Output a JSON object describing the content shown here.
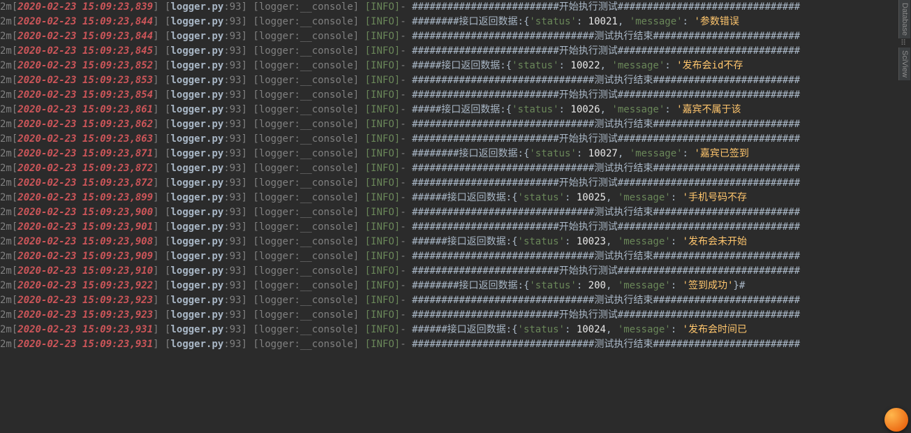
{
  "tools": {
    "database": "Database",
    "sciview": "SciView"
  },
  "log": {
    "prefix2m": "2m[",
    "file": "logger.py",
    "lineNo": "93",
    "logger": " [logger:__console] ",
    "level": "[INFO]",
    "dash": "- ",
    "hash_long": "#########################",
    "hash_longer": "###############################",
    "hash_mid": "########",
    "hash_short": "#####",
    "start": "开始执行测试",
    "end": "测试执行结束",
    "resp": "接口返回数据:",
    "statusKey": "'status'",
    "messageKey": "'message'",
    "colon": ": ",
    "comma": ", ",
    "brace_o": "{",
    "brace_c": "}",
    "tail_hashes": "###################",
    "entries": [
      {
        "ts": "2020-02-23 15:09:23,839",
        "type": "start"
      },
      {
        "ts": "2020-02-23 15:09:23,844",
        "type": "resp",
        "status": "10021",
        "msg": "参数错误",
        "h": "########"
      },
      {
        "ts": "2020-02-23 15:09:23,844",
        "type": "end"
      },
      {
        "ts": "2020-02-23 15:09:23,845",
        "type": "start"
      },
      {
        "ts": "2020-02-23 15:09:23,852",
        "type": "resp",
        "status": "10022",
        "msg": "发布会id不存",
        "h": "#####"
      },
      {
        "ts": "2020-02-23 15:09:23,853",
        "type": "end"
      },
      {
        "ts": "2020-02-23 15:09:23,854",
        "type": "start"
      },
      {
        "ts": "2020-02-23 15:09:23,861",
        "type": "resp",
        "status": "10026",
        "msg": "嘉宾不属于该",
        "h": "#####"
      },
      {
        "ts": "2020-02-23 15:09:23,862",
        "type": "end"
      },
      {
        "ts": "2020-02-23 15:09:23,863",
        "type": "start"
      },
      {
        "ts": "2020-02-23 15:09:23,871",
        "type": "resp",
        "status": "10027",
        "msg": "嘉宾已签到",
        "h": "########"
      },
      {
        "ts": "2020-02-23 15:09:23,872",
        "type": "end"
      },
      {
        "ts": "2020-02-23 15:09:23,872",
        "type": "start"
      },
      {
        "ts": "2020-02-23 15:09:23,899",
        "type": "resp",
        "status": "10025",
        "msg": "手机号码不存",
        "h": "######"
      },
      {
        "ts": "2020-02-23 15:09:23,900",
        "type": "end"
      },
      {
        "ts": "2020-02-23 15:09:23,901",
        "type": "start"
      },
      {
        "ts": "2020-02-23 15:09:23,908",
        "type": "resp",
        "status": "10023",
        "msg": "发布会未开始",
        "h": "######"
      },
      {
        "ts": "2020-02-23 15:09:23,909",
        "type": "end"
      },
      {
        "ts": "2020-02-23 15:09:23,910",
        "type": "start"
      },
      {
        "ts": "2020-02-23 15:09:23,922",
        "type": "resp",
        "status": "200",
        "msg": "签到成功",
        "h": "########",
        "closeHash": true
      },
      {
        "ts": "2020-02-23 15:09:23,923",
        "type": "end"
      },
      {
        "ts": "2020-02-23 15:09:23,923",
        "type": "start"
      },
      {
        "ts": "2020-02-23 15:09:23,931",
        "type": "resp",
        "status": "10024",
        "msg": "发布会时间已",
        "h": "######"
      },
      {
        "ts": "2020-02-23 15:09:23,931",
        "type": "end"
      }
    ]
  }
}
